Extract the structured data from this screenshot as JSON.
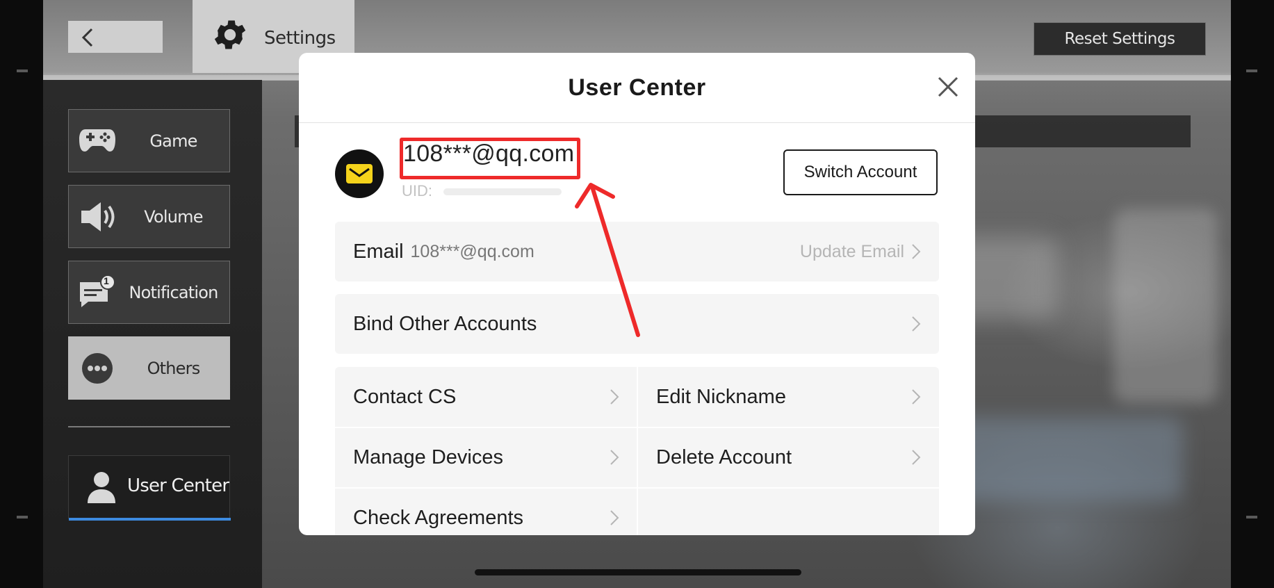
{
  "header": {
    "settings_label": "Settings",
    "reset_label": "Reset Settings"
  },
  "sidebar": {
    "items": [
      {
        "label": "Game",
        "icon": "gamepad-icon"
      },
      {
        "label": "Volume",
        "icon": "speaker-icon"
      },
      {
        "label": "Notification",
        "icon": "message-icon",
        "badge": "1"
      },
      {
        "label": "Others",
        "icon": "more-icon"
      }
    ],
    "user_center": {
      "label": "User Center",
      "icon": "user-icon"
    }
  },
  "modal": {
    "title": "User Center",
    "account": {
      "email": "108***@qq.com",
      "uid_label": "UID:",
      "switch_label": "Switch Account"
    },
    "email_row": {
      "label": "Email",
      "value": "108***@qq.com",
      "action": "Update Email"
    },
    "bind_row": {
      "label": "Bind Other Accounts"
    },
    "grid": [
      {
        "label": "Contact CS"
      },
      {
        "label": "Edit Nickname"
      },
      {
        "label": "Manage Devices"
      },
      {
        "label": "Delete Account"
      },
      {
        "label": "Check Agreements"
      }
    ]
  },
  "colors": {
    "highlight": "#ee2a2a",
    "accent_blue": "#3d8be0",
    "avatar_mail": "#f5d31b"
  }
}
